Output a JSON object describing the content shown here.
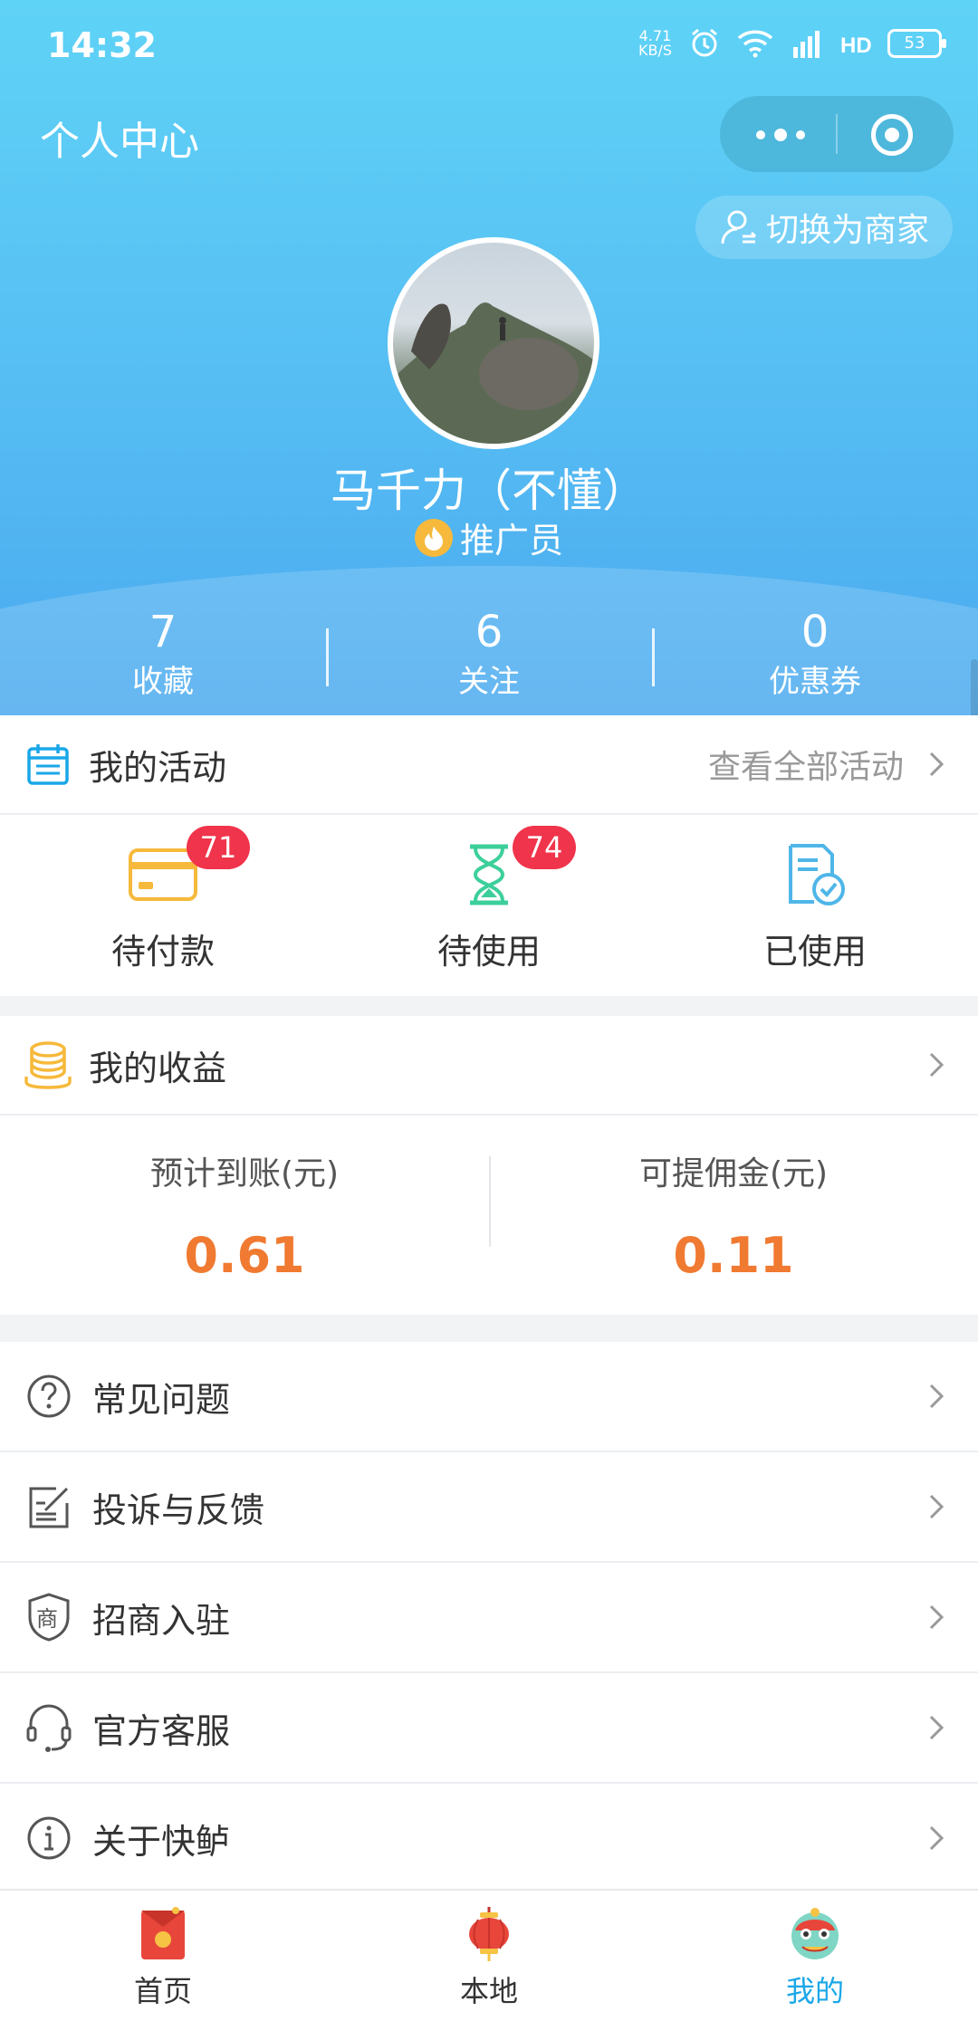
{
  "status_bar": {
    "time": "14:32",
    "net_speed_top": "4.71",
    "net_speed_unit": "KB/S",
    "battery": "53"
  },
  "header": {
    "title": "个人中心",
    "switch_label": "切换为商家",
    "username": "马千力（不懂）",
    "role": "推广员",
    "stats": [
      {
        "value": "7",
        "label": "收藏"
      },
      {
        "value": "6",
        "label": "关注"
      },
      {
        "value": "0",
        "label": "优惠券"
      }
    ]
  },
  "activities": {
    "title": "我的活动",
    "more": "查看全部活动",
    "items": [
      {
        "label": "待付款",
        "badge": "71"
      },
      {
        "label": "待使用",
        "badge": "74"
      },
      {
        "label": "已使用"
      }
    ]
  },
  "earnings": {
    "title": "我的收益",
    "cols": [
      {
        "label": "预计到账(元)",
        "value": "0.61"
      },
      {
        "label": "可提佣金(元)",
        "value": "0.11"
      }
    ]
  },
  "menu": [
    {
      "label": "常见问题"
    },
    {
      "label": "投诉与反馈"
    },
    {
      "label": "招商入驻"
    },
    {
      "label": "官方客服"
    },
    {
      "label": "关于快鲈"
    }
  ],
  "tabbar": [
    {
      "label": "首页"
    },
    {
      "label": "本地"
    },
    {
      "label": "我的"
    }
  ],
  "colors": {
    "accent": "#1aa7e8",
    "badge": "#f0344b",
    "amount": "#f07a31"
  }
}
